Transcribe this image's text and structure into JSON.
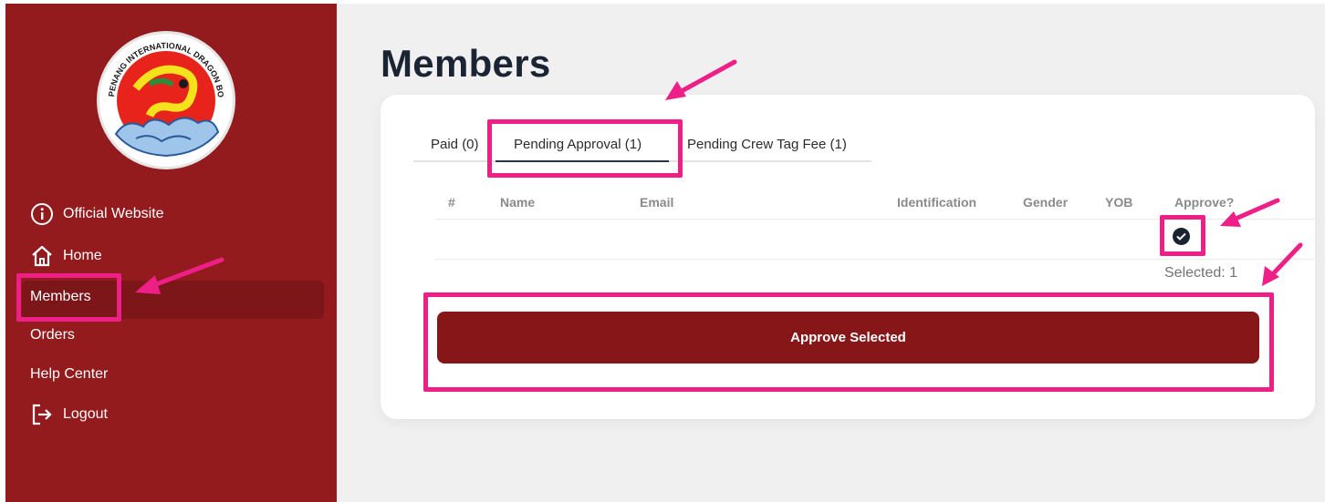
{
  "app": {
    "logo_ring_text": "PENANG INTERNATIONAL DRAGON BOAT FESTIVAL"
  },
  "sidebar": {
    "items": [
      {
        "label": "Official Website",
        "icon": "info-circle-icon"
      },
      {
        "label": "Home",
        "icon": "home-icon"
      },
      {
        "label": "Members",
        "active": true
      },
      {
        "label": "Orders"
      },
      {
        "label": "Help Center"
      },
      {
        "label": "Logout",
        "icon": "logout-icon"
      }
    ]
  },
  "main": {
    "title": "Members",
    "tabs": [
      {
        "label": "Paid (0)"
      },
      {
        "label": "Pending Approval (1)",
        "active": true
      },
      {
        "label": "Pending Crew Tag Fee (1)"
      }
    ],
    "table": {
      "columns": [
        "#",
        "Name",
        "Email",
        "Identification",
        "Gender",
        "YOB",
        "Approve?"
      ],
      "rows": [
        {
          "num": "",
          "name": "",
          "email": "",
          "identification": "",
          "gender": "",
          "yob": "",
          "approve": true
        }
      ]
    },
    "selected_text": "Selected: 1",
    "approve_button": "Approve Selected"
  },
  "colors": {
    "sidebar": "#931a1d",
    "active_item": "#7c1618",
    "button": "#861618",
    "highlight": "#ee1f86",
    "title": "#1a2433"
  }
}
